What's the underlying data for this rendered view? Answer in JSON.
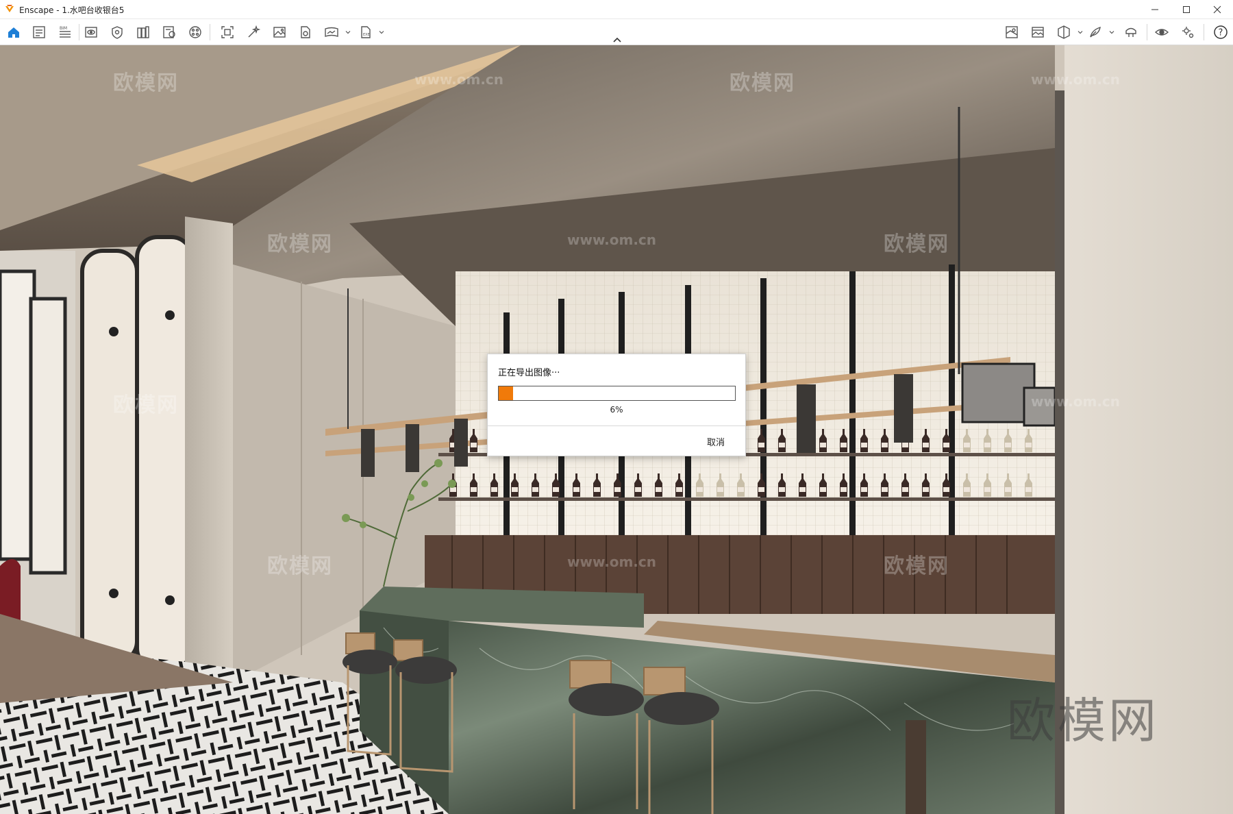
{
  "window": {
    "app_name": "Enscape",
    "title": "Enscape - 1.水吧台收银台5",
    "controls": [
      "minimize",
      "maximize",
      "close"
    ]
  },
  "toolbar": {
    "left_icons": [
      "home-icon",
      "document-icon",
      "bim-icon",
      "view-icon",
      "visual-settings-icon",
      "views-library-icon",
      "material-editor-icon",
      "asset-library-icon",
      "screenshot-icon",
      "magic-wand-icon",
      "image-icon",
      "render-file-icon",
      "panorama-icon",
      "export-icon"
    ],
    "right_icons": [
      "map-icon",
      "gallery-icon",
      "cube-icon",
      "feather-icon",
      "vr-headset-icon",
      "eye-icon",
      "settings-icon",
      "help-icon"
    ],
    "help_label": "?"
  },
  "viewport": {
    "watermarks": [
      "欧模网",
      "www.om.cn"
    ],
    "corner_watermark": "欧模网"
  },
  "export_dialog": {
    "title": "正在导出图像···",
    "progress": 0.06,
    "progress_text": "6%",
    "progress_color": "#f07a0a",
    "cancel_label": "取消"
  }
}
